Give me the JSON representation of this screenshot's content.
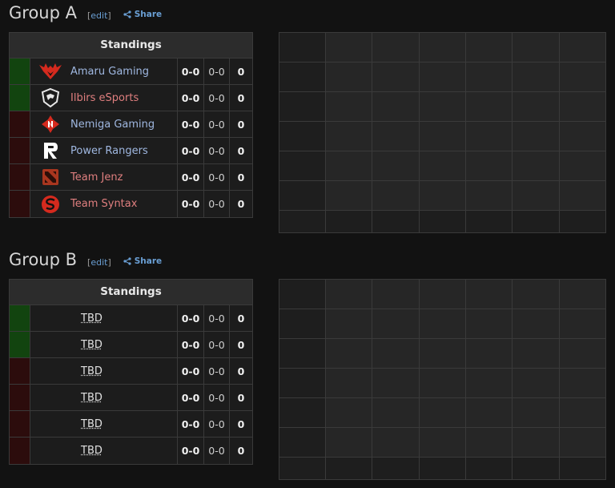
{
  "colors": {
    "background": "#121212",
    "qualify": "#12440f",
    "eliminated": "#2c0c0c",
    "link": "#6a9fd4",
    "team_blue": "#9fb7e0",
    "team_red": "#e07f7f"
  },
  "groups": [
    {
      "title": "Group A",
      "edit_label": "edit",
      "share_label": "Share",
      "standings_label": "Standings",
      "rows": [
        {
          "team": "Amaru Gaming",
          "logo_icon": "amaru-gaming-logo-icon",
          "status": "up",
          "name_color": "blue",
          "series": "0-0",
          "games": "0-0",
          "points": "0"
        },
        {
          "team": "Ilbirs eSports",
          "logo_icon": "ilbirs-esports-logo-icon",
          "status": "up",
          "name_color": "red",
          "series": "0-0",
          "games": "0-0",
          "points": "0"
        },
        {
          "team": "Nemiga Gaming",
          "logo_icon": "nemiga-gaming-logo-icon",
          "status": "down",
          "name_color": "blue",
          "series": "0-0",
          "games": "0-0",
          "points": "0"
        },
        {
          "team": "Power Rangers",
          "logo_icon": "power-rangers-logo-icon",
          "status": "down",
          "name_color": "blue",
          "series": "0-0",
          "games": "0-0",
          "points": "0"
        },
        {
          "team": "Team Jenz",
          "logo_icon": "dota-logo-icon",
          "status": "down",
          "name_color": "red",
          "series": "0-0",
          "games": "0-0",
          "points": "0"
        },
        {
          "team": "Team Syntax",
          "logo_icon": "team-syntax-logo-icon",
          "status": "down",
          "name_color": "red",
          "series": "0-0",
          "games": "0-0",
          "points": "0"
        }
      ]
    },
    {
      "title": "Group B",
      "edit_label": "edit",
      "share_label": "Share",
      "standings_label": "Standings",
      "rows": [
        {
          "team": "TBD",
          "status": "up",
          "series": "0-0",
          "games": "0-0",
          "points": "0"
        },
        {
          "team": "TBD",
          "status": "up",
          "series": "0-0",
          "games": "0-0",
          "points": "0"
        },
        {
          "team": "TBD",
          "status": "down",
          "series": "0-0",
          "games": "0-0",
          "points": "0"
        },
        {
          "team": "TBD",
          "status": "down",
          "series": "0-0",
          "games": "0-0",
          "points": "0"
        },
        {
          "team": "TBD",
          "status": "down",
          "series": "0-0",
          "games": "0-0",
          "points": "0"
        },
        {
          "team": "TBD",
          "status": "down",
          "series": "0-0",
          "games": "0-0",
          "points": "0"
        }
      ]
    }
  ]
}
